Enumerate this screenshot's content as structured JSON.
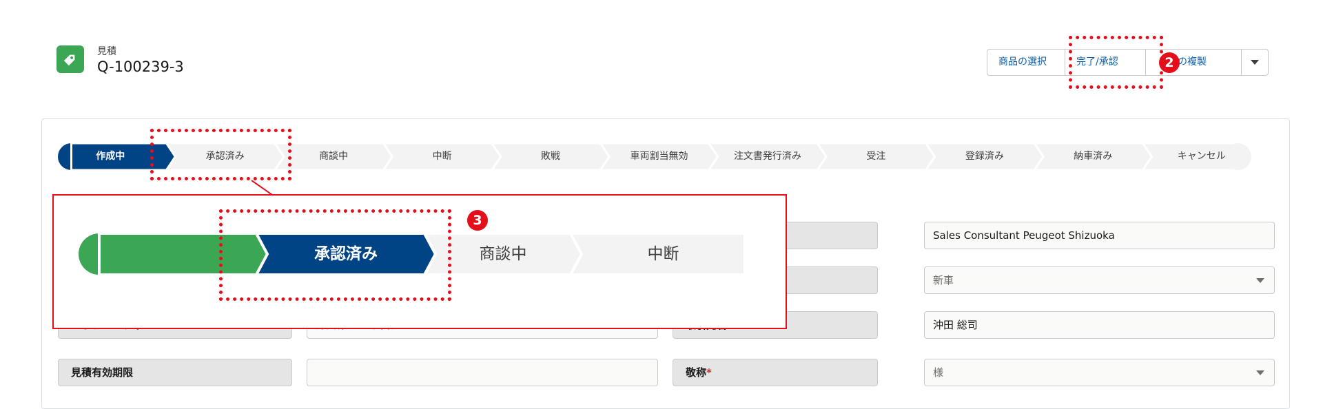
{
  "header": {
    "object_type": "見積",
    "record_name": "Q-100239-3",
    "icon": "tag-icon",
    "icon_color": "#3ba755",
    "buttons": {
      "select_products": "商品の選択",
      "complete_approve": "完了/承認",
      "copy_quote": "積の複製",
      "more": "chevron-down-icon"
    }
  },
  "path": {
    "current_step": "作成中",
    "steps": [
      "作成中",
      "承認済み",
      "商談中",
      "中断",
      "敗戦",
      "車両割当無効",
      "注文書発行済み",
      "受注",
      "登録済み",
      "納車済み",
      "キャンセル"
    ],
    "colors": {
      "current": "#014486",
      "incomplete": "#f3f3f3",
      "complete": "#3ba755"
    }
  },
  "zoom": {
    "steps": [
      "承認済み",
      "商談中",
      "中断"
    ],
    "colors": {
      "complete": "#3ba755",
      "current": "#014486"
    }
  },
  "form": {
    "right_fields": {
      "consultant_value": "Sales Consultant Peugeot Shizuoka",
      "type_value": "新車",
      "account_label": "取引先名",
      "account_value": "沖田 総司",
      "honorific_label": "敬称",
      "honorific_value": "様"
    },
    "left_fields": {
      "opportunity_label": "オポチュニティ",
      "opportunity_value": "沖田様3008試乗",
      "valid_until_label": "見積有効期限",
      "valid_until_value": ""
    },
    "required_mark": "*"
  },
  "annotations": {
    "badge_2": "2",
    "badge_3": "3",
    "accent": "#e3101b"
  }
}
